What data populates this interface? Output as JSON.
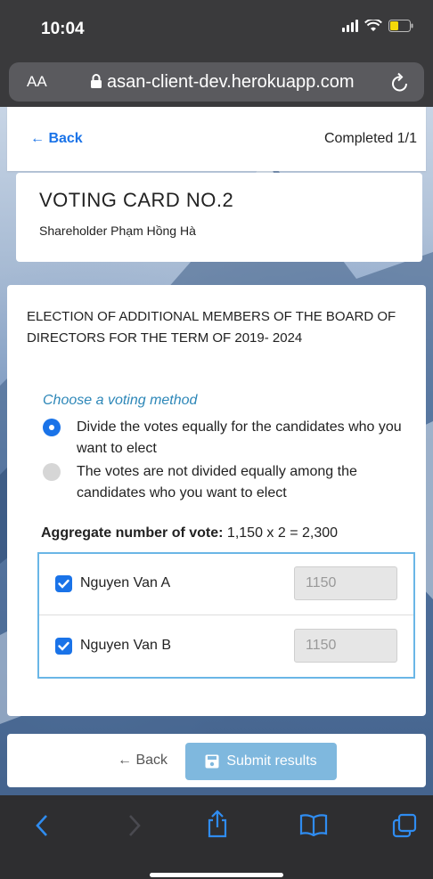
{
  "status_bar": {
    "time": "10:04"
  },
  "url_bar": {
    "aa_label": "AA",
    "url": "asan-client-dev.herokuapp.com"
  },
  "header": {
    "back_label": "Back",
    "completed_label": "Completed 1/1"
  },
  "card": {
    "title": "VOTING CARD NO.2",
    "subtitle": "Shareholder Phạm Hồng Hà"
  },
  "election": {
    "title": "ELECTION OF ADDITIONAL MEMBERS OF THE BOARD OF DIRECTORS FOR THE TERM OF 2019- 2024",
    "choose_label": "Choose a voting method",
    "options": [
      {
        "label": "Divide the votes equally for the candidates who you want to elect",
        "selected": true
      },
      {
        "label": "The votes are not divided equally among the candidates who you want to elect",
        "selected": false
      }
    ],
    "aggregate_label": "Aggregate number of vote:",
    "aggregate_value": "1,150 x 2 = 2,300",
    "candidates": [
      {
        "name": "Nguyen Van A",
        "votes": "1150",
        "checked": true
      },
      {
        "name": "Nguyen Van B",
        "votes": "1150",
        "checked": true
      }
    ]
  },
  "footer": {
    "back_label": "Back",
    "submit_label": "Submit results"
  },
  "colors": {
    "accent": "#1a73e8",
    "submit": "#7fb8de",
    "candidate_border": "#6ab6e6",
    "choose_label": "#2d87b8"
  },
  "toolbar": {
    "icons": [
      "chevron-left-icon",
      "chevron-right-icon",
      "share-icon",
      "bookmarks-icon",
      "tabs-icon"
    ]
  }
}
